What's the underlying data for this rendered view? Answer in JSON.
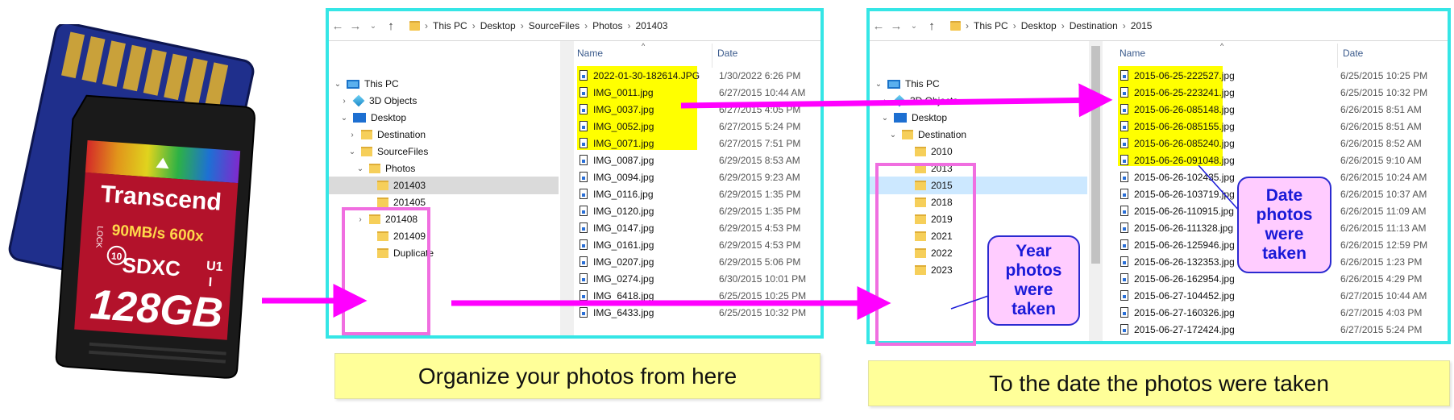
{
  "sd_card": {
    "brand": "Transcend",
    "speed": "90MB/s",
    "rating": "600x",
    "capacity": "128",
    "unit": "GB",
    "lock_label": "LOCK",
    "type": "SDXC",
    "class_mark": "10",
    "uhs_mark": "U1",
    "bus_mark": "I"
  },
  "left_window": {
    "breadcrumb": [
      "This PC",
      "Desktop",
      "SourceFiles",
      "Photos",
      "201403"
    ],
    "tree": [
      {
        "label": "This PC",
        "icon": "pc-icon"
      },
      {
        "label": "3D Objects",
        "icon": "cube-icon"
      },
      {
        "label": "Desktop",
        "icon": "desktop-icon"
      },
      {
        "label": "Destination",
        "icon": "folder-icon"
      },
      {
        "label": "SourceFiles",
        "icon": "folder-icon"
      },
      {
        "label": "Photos",
        "icon": "folder-icon"
      },
      {
        "label": "201403",
        "icon": "folder-icon"
      },
      {
        "label": "201405",
        "icon": "folder-icon"
      },
      {
        "label": "201408",
        "icon": "folder-icon"
      },
      {
        "label": "201409",
        "icon": "folder-icon"
      },
      {
        "label": "Duplicate",
        "icon": "folder-icon"
      }
    ],
    "columns": {
      "name": "Name",
      "date": "Date"
    },
    "files": [
      {
        "name": "2022-01-30-182614.JPG",
        "date": "1/30/2022 6:26 PM"
      },
      {
        "name": "IMG_0011.jpg",
        "date": "6/27/2015 10:44 AM"
      },
      {
        "name": "IMG_0037.jpg",
        "date": "6/27/2015 4:05 PM"
      },
      {
        "name": "IMG_0052.jpg",
        "date": "6/27/2015 5:24 PM"
      },
      {
        "name": "IMG_0071.jpg",
        "date": "6/27/2015 7:51 PM"
      },
      {
        "name": "IMG_0087.jpg",
        "date": "6/29/2015 8:53 AM"
      },
      {
        "name": "IMG_0094.jpg",
        "date": "6/29/2015 9:23 AM"
      },
      {
        "name": "IMG_0116.jpg",
        "date": "6/29/2015 1:35 PM"
      },
      {
        "name": "IMG_0120.jpg",
        "date": "6/29/2015 1:35 PM"
      },
      {
        "name": "IMG_0147.jpg",
        "date": "6/29/2015 4:53 PM"
      },
      {
        "name": "IMG_0161.jpg",
        "date": "6/29/2015 4:53 PM"
      },
      {
        "name": "IMG_0207.jpg",
        "date": "6/29/2015 5:06 PM"
      },
      {
        "name": "IMG_0274.jpg",
        "date": "6/30/2015 10:01 PM"
      },
      {
        "name": "IMG_6418.jpg",
        "date": "6/25/2015 10:25 PM"
      },
      {
        "name": "IMG_6433.jpg",
        "date": "6/25/2015 10:32 PM"
      }
    ]
  },
  "right_window": {
    "breadcrumb": [
      "This PC",
      "Desktop",
      "Destination",
      "2015"
    ],
    "tree": [
      {
        "label": "This PC",
        "icon": "pc-icon"
      },
      {
        "label": "3D Objects",
        "icon": "cube-icon"
      },
      {
        "label": "Desktop",
        "icon": "desktop-icon"
      },
      {
        "label": "Destination",
        "icon": "folder-icon"
      },
      {
        "label": "2010",
        "icon": "folder-icon"
      },
      {
        "label": "2013",
        "icon": "folder-icon"
      },
      {
        "label": "2015",
        "icon": "folder-icon"
      },
      {
        "label": "2018",
        "icon": "folder-icon"
      },
      {
        "label": "2019",
        "icon": "folder-icon"
      },
      {
        "label": "2021",
        "icon": "folder-icon"
      },
      {
        "label": "2022",
        "icon": "folder-icon"
      },
      {
        "label": "2023",
        "icon": "folder-icon"
      }
    ],
    "columns": {
      "name": "Name",
      "date": "Date"
    },
    "files": [
      {
        "name": "2015-06-25-222527.jpg",
        "date": "6/25/2015 10:25 PM"
      },
      {
        "name": "2015-06-25-223241.jpg",
        "date": "6/25/2015 10:32 PM"
      },
      {
        "name": "2015-06-26-085148.jpg",
        "date": "6/26/2015 8:51 AM"
      },
      {
        "name": "2015-06-26-085155.jpg",
        "date": "6/26/2015 8:51 AM"
      },
      {
        "name": "2015-06-26-085240.jpg",
        "date": "6/26/2015 8:52 AM"
      },
      {
        "name": "2015-06-26-091048.jpg",
        "date": "6/26/2015 9:10 AM"
      },
      {
        "name": "2015-06-26-102435.jpg",
        "date": "6/26/2015 10:24 AM"
      },
      {
        "name": "2015-06-26-103719.jpg",
        "date": "6/26/2015 10:37 AM"
      },
      {
        "name": "2015-06-26-110915.jpg",
        "date": "6/26/2015 11:09 AM"
      },
      {
        "name": "2015-06-26-111328.jpg",
        "date": "6/26/2015 11:13 AM"
      },
      {
        "name": "2015-06-26-125946.jpg",
        "date": "6/26/2015 12:59 PM"
      },
      {
        "name": "2015-06-26-132353.jpg",
        "date": "6/26/2015 1:23 PM"
      },
      {
        "name": "2015-06-26-162954.jpg",
        "date": "6/26/2015 4:29 PM"
      },
      {
        "name": "2015-06-27-104452.jpg",
        "date": "6/27/2015 10:44 AM"
      },
      {
        "name": "2015-06-27-160326.jpg",
        "date": "6/27/2015 4:03 PM"
      },
      {
        "name": "2015-06-27-172424.jpg",
        "date": "6/27/2015 5:24 PM"
      }
    ]
  },
  "captions": {
    "left": "Organize your photos from here",
    "right": "To the date the photos were taken"
  },
  "callouts": {
    "year": "Year\nphotos\nwere\ntaken",
    "date": "Date\nphotos\nwere\ntaken"
  },
  "colors": {
    "window_border": "#35e6e6",
    "highlight": "#ffff00",
    "arrow": "#ff00ff",
    "caption_bg": "#ffff99",
    "callout_bg": "#ffccff",
    "callout_text": "#1a1ad8"
  }
}
